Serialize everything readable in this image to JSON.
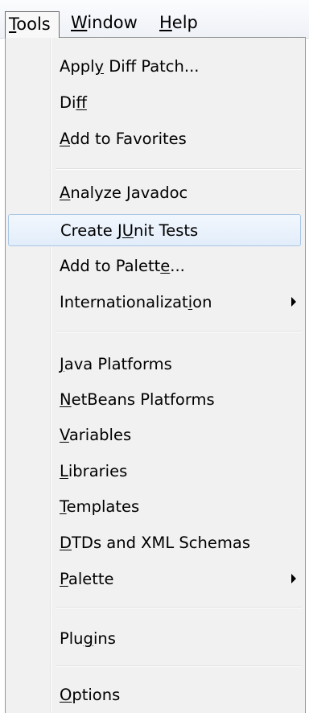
{
  "menubar": {
    "items": [
      {
        "label": "Tools",
        "mnemonic_index": 0,
        "active": true
      },
      {
        "label": "Window",
        "mnemonic_index": 0,
        "active": false
      },
      {
        "label": "Help",
        "mnemonic_index": 0,
        "active": false
      }
    ]
  },
  "menu": {
    "title": "Tools",
    "items": [
      {
        "type": "item",
        "label": "Apply Diff Patch...",
        "mnemonic_index": 4
      },
      {
        "type": "item",
        "label": "Diff",
        "mnemonic_index": 2
      },
      {
        "type": "item",
        "label": "Add to Favorites",
        "mnemonic_index": 0
      },
      {
        "type": "separator"
      },
      {
        "type": "item",
        "label": "Analyze Javadoc",
        "mnemonic_index": 0
      },
      {
        "type": "item",
        "label": "Create JUnit Tests",
        "mnemonic_index": 8,
        "highlighted": true
      },
      {
        "type": "item",
        "label": "Add to Palette...",
        "mnemonic_index": 13
      },
      {
        "type": "item",
        "label": "Internationalization",
        "mnemonic_index": 17,
        "submenu": true
      },
      {
        "type": "separator"
      },
      {
        "type": "item",
        "label": "Java Platforms",
        "mnemonic_index": 0
      },
      {
        "type": "item",
        "label": "NetBeans Platforms",
        "mnemonic_index": 0
      },
      {
        "type": "item",
        "label": "Variables",
        "mnemonic_index": 0
      },
      {
        "type": "item",
        "label": "Libraries",
        "mnemonic_index": 0
      },
      {
        "type": "item",
        "label": "Templates",
        "mnemonic_index": 0
      },
      {
        "type": "item",
        "label": "DTDs and XML Schemas",
        "mnemonic_index": 0
      },
      {
        "type": "item",
        "label": "Palette",
        "mnemonic_index": 0,
        "submenu": true
      },
      {
        "type": "separator"
      },
      {
        "type": "item",
        "label": "Plugins",
        "mnemonic_index": 3
      },
      {
        "type": "separator"
      },
      {
        "type": "item",
        "label": "Options",
        "mnemonic_index": 0
      }
    ]
  },
  "colors": {
    "highlight_border": "#a9c6e4",
    "highlight_fill": "#e2edfa",
    "menu_background": "#f1f1f1"
  }
}
